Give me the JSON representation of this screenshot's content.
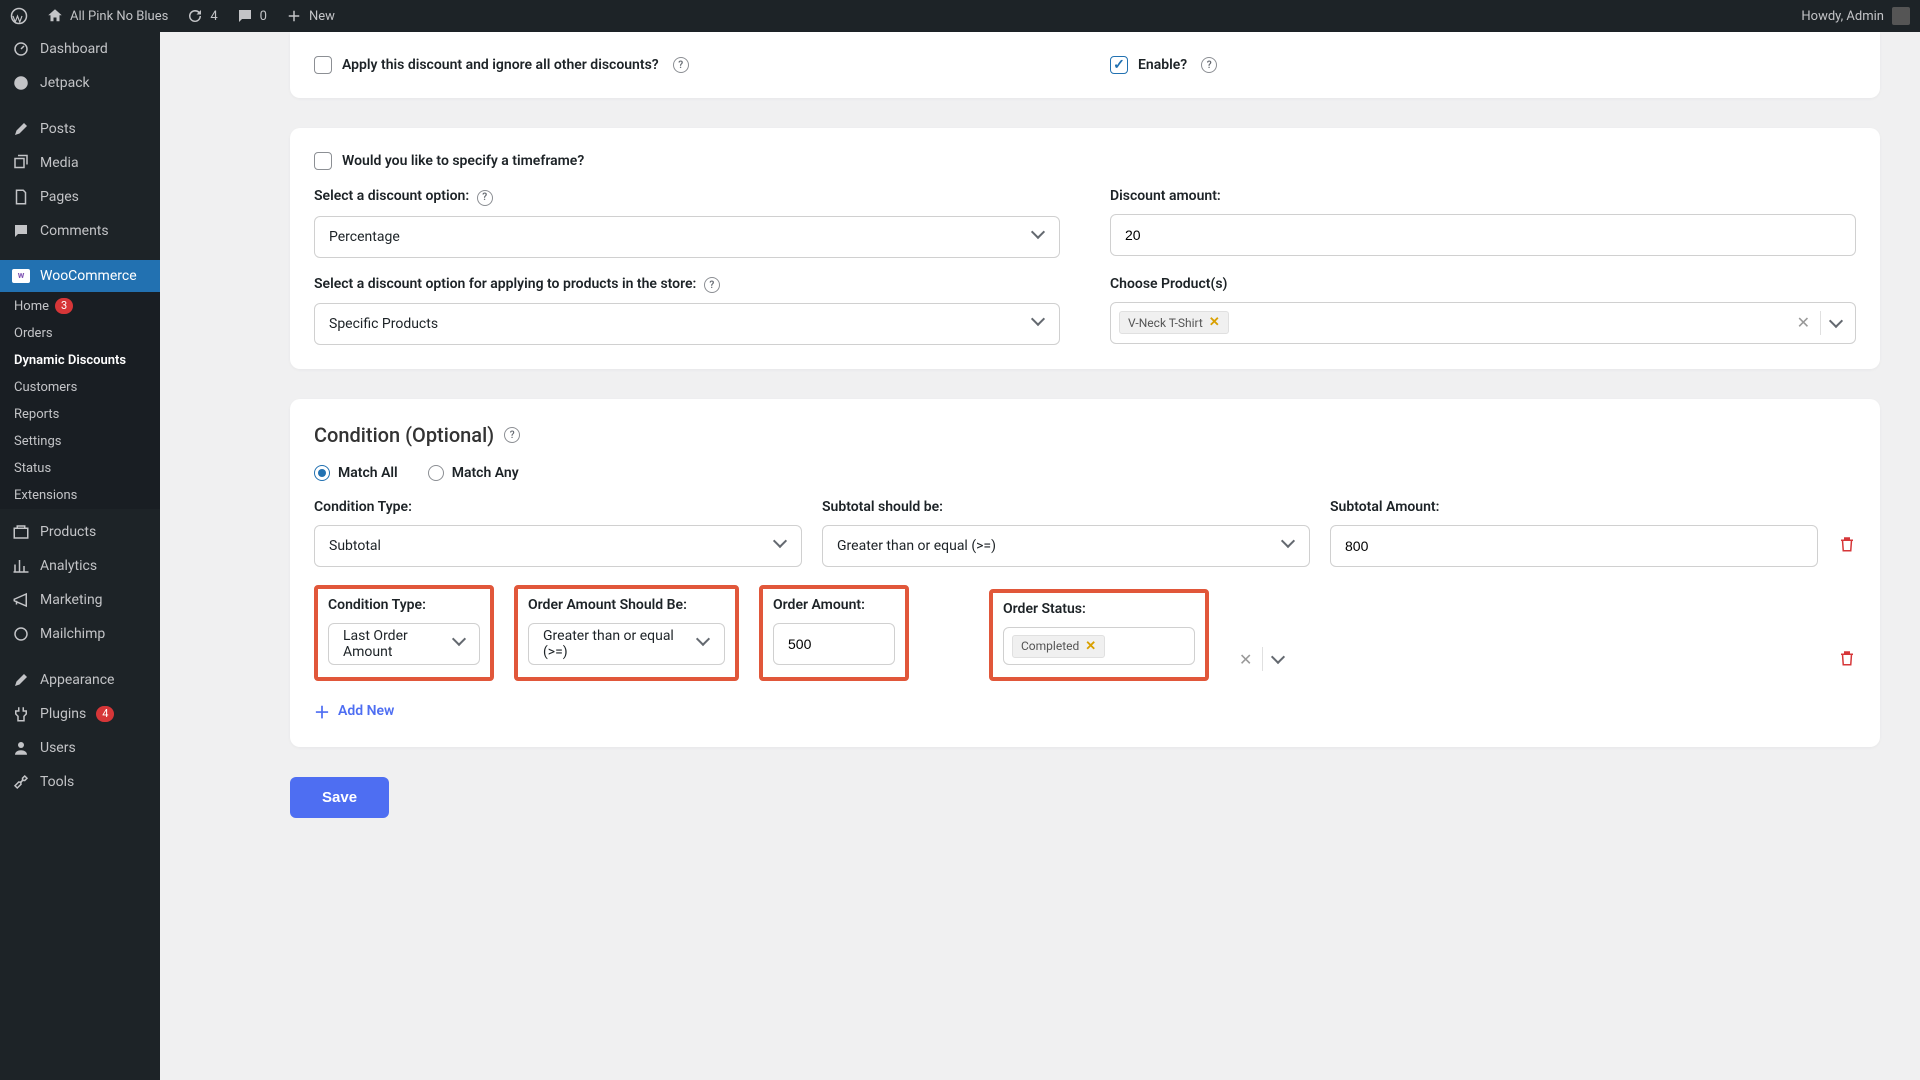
{
  "adminbar": {
    "site_name": "All Pink No Blues",
    "updates": "4",
    "comments": "0",
    "new_label": "New",
    "howdy": "Howdy, Admin"
  },
  "sidebar": {
    "dashboard": "Dashboard",
    "jetpack": "Jetpack",
    "posts": "Posts",
    "media": "Media",
    "pages": "Pages",
    "comments": "Comments",
    "woocommerce": "WooCommerce",
    "woo_items": {
      "home": "Home",
      "home_badge": "3",
      "orders": "Orders",
      "dynamic_discounts": "Dynamic Discounts",
      "customers": "Customers",
      "reports": "Reports",
      "settings": "Settings",
      "status": "Status",
      "extensions": "Extensions"
    },
    "products": "Products",
    "analytics": "Analytics",
    "marketing": "Marketing",
    "mailchimp": "Mailchimp",
    "appearance": "Appearance",
    "plugins": "Plugins",
    "plugins_badge": "4",
    "users": "Users",
    "tools": "Tools"
  },
  "panel1": {
    "apply_ignore": "Apply this discount and ignore all other discounts?",
    "enable": "Enable?"
  },
  "panel2": {
    "timeframe": "Would you like to specify a timeframe?",
    "discount_option_label": "Select a discount option:",
    "discount_option_value": "Percentage",
    "discount_amount_label": "Discount amount:",
    "discount_amount_value": "20",
    "apply_label": "Select a discount option for applying to products in the store:",
    "apply_value": "Specific Products",
    "choose_products_label": "Choose Product(s)",
    "product_tag": "V-Neck T-Shirt"
  },
  "panel3": {
    "title": "Condition (Optional)",
    "match_all": "Match All",
    "match_any": "Match Any",
    "row1": {
      "type_label": "Condition Type:",
      "type_value": "Subtotal",
      "should_label": "Subtotal should be:",
      "should_value": "Greater than or equal (>=)",
      "amount_label": "Subtotal Amount:",
      "amount_value": "800"
    },
    "row2": {
      "type_label": "Condition Type:",
      "type_value": "Last Order Amount",
      "should_label": "Order Amount Should Be:",
      "should_value": "Greater than or equal (>=)",
      "amount_label": "Order Amount:",
      "amount_value": "500",
      "status_label": "Order Status:",
      "status_tag": "Completed"
    },
    "add_new": "Add New"
  },
  "save": "Save"
}
